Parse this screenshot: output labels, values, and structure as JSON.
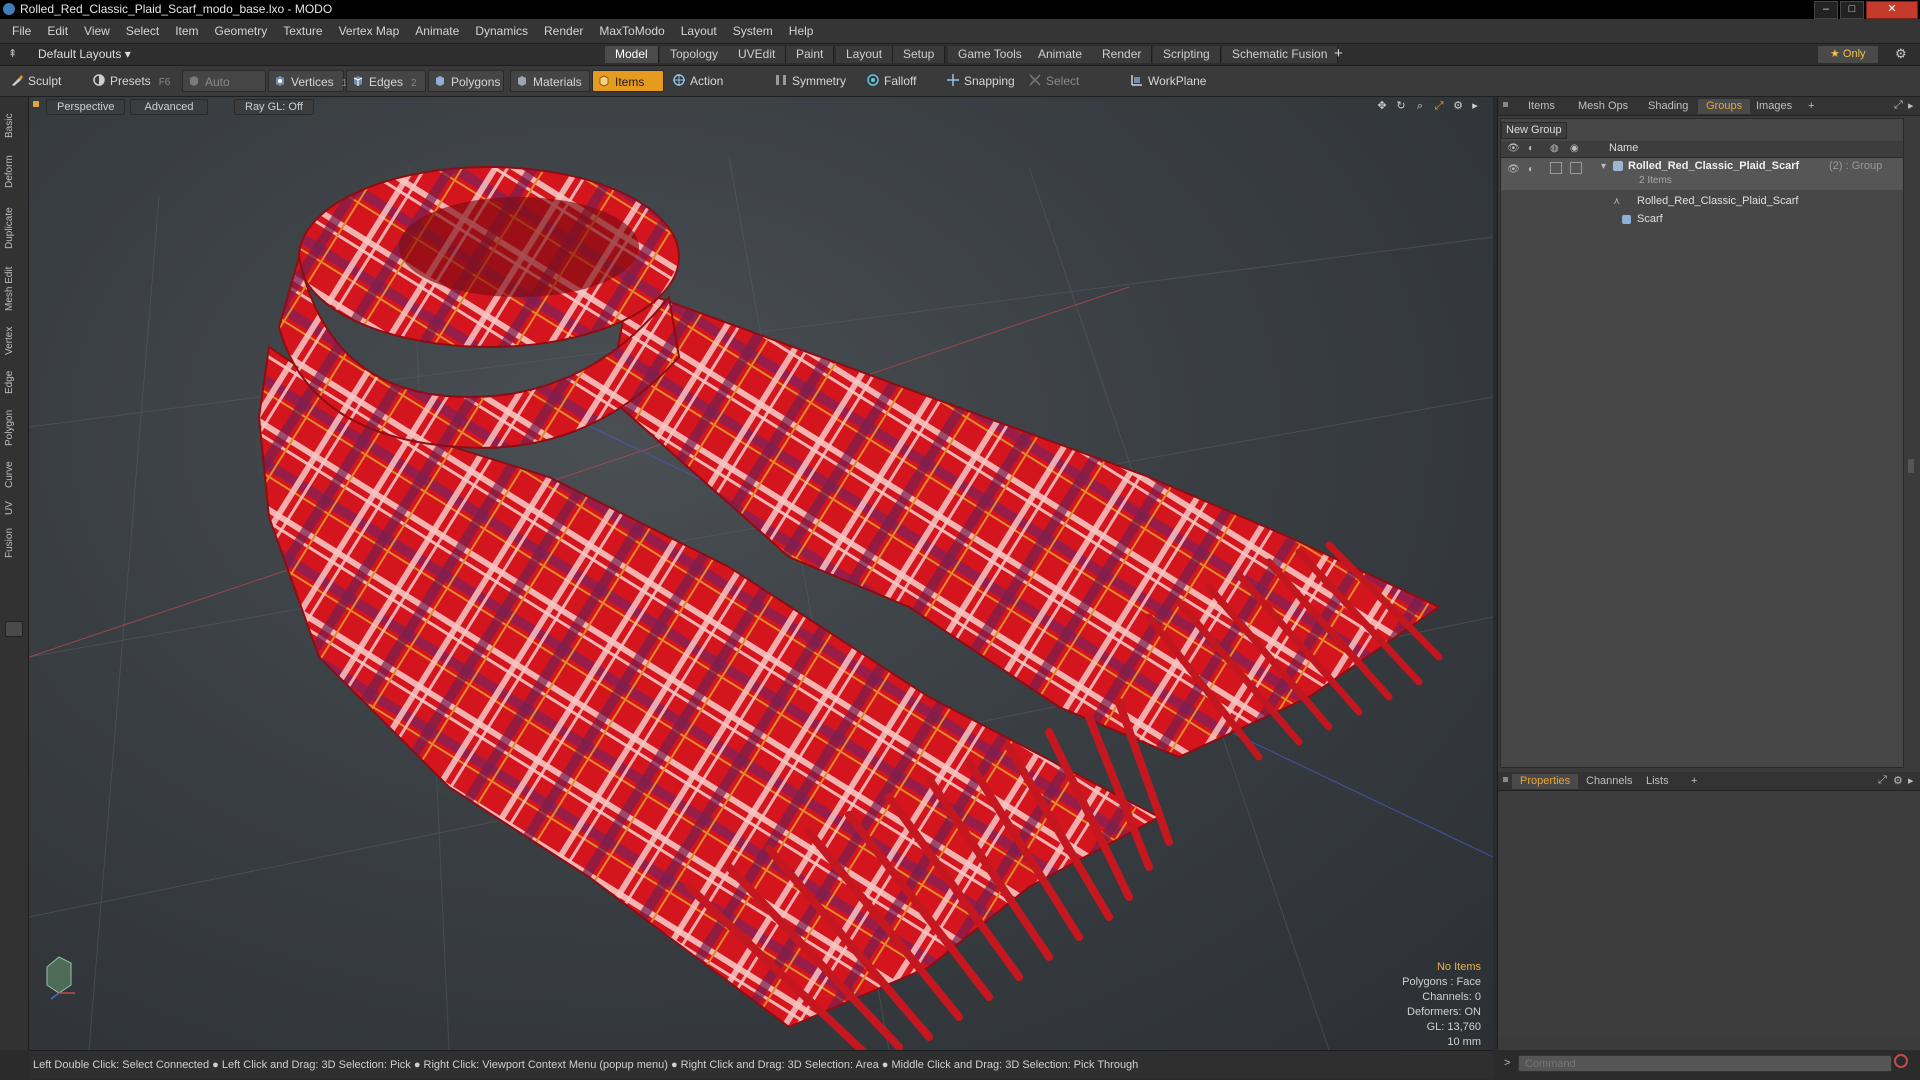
{
  "window": {
    "title": "Rolled_Red_Classic_Plaid_Scarf_modo_base.lxo - MODO",
    "controls": [
      "–",
      "□",
      "✕"
    ]
  },
  "menu": [
    "File",
    "Edit",
    "View",
    "Select",
    "Item",
    "Geometry",
    "Texture",
    "Vertex Map",
    "Animate",
    "Dynamics",
    "Render",
    "MaxToModo",
    "Layout",
    "System",
    "Help"
  ],
  "layout_bar": {
    "preset": "Default Layouts ▾",
    "tabs": [
      "Model",
      "Topology",
      "UVEdit",
      "Paint",
      "Layout",
      "Setup",
      "Game Tools",
      "Animate",
      "Render",
      "Scripting",
      "Schematic Fusion"
    ],
    "active_tab": "Model",
    "add_label": "+",
    "only_label": "★  Only"
  },
  "toolbar": {
    "sculpt": "Sculpt",
    "presets": "Presets",
    "presets_key": "F6",
    "auto_select": "Auto Select",
    "vertices": "Vertices",
    "vertices_count": "1",
    "edges": "Edges",
    "edges_count": "2",
    "polygons": "Polygons",
    "materials": "Materials",
    "items": "Items",
    "action_center": "Action Center",
    "symmetry": "Symmetry",
    "falloff": "Falloff",
    "snapping": "Snapping",
    "select_through": "Select Through",
    "workplane": "WorkPlane",
    "accent": "#e69a1e"
  },
  "left_tabs": [
    "Basic",
    "Deform",
    "Duplicate",
    "Mesh Edit",
    "Vertex",
    "Edge",
    "Polygon",
    "Curve",
    "UV",
    "Fusion"
  ],
  "viewport": {
    "view": "Perspective",
    "shading": "Advanced",
    "raygl": "Ray GL: Off",
    "stats": {
      "items": "No Items",
      "polygons": "Polygons : Face",
      "channels": "Channels: 0",
      "deformers": "Deformers: ON",
      "gl": "GL: 13,760",
      "scale": "10 mm"
    }
  },
  "groups_panel": {
    "tabs": [
      "Items",
      "Mesh Ops",
      "Shading",
      "Groups",
      "Images",
      "+"
    ],
    "active_tab": "Groups",
    "new_group": "New Group",
    "column_name": "Name",
    "group_name": "Rolled_Red_Classic_Plaid_Scarf",
    "group_suffix": "(2) : Group",
    "group_count": "2 Items",
    "children": [
      "Rolled_Red_Classic_Plaid_Scarf",
      "Scarf"
    ]
  },
  "properties_panel": {
    "tabs": [
      "Properties",
      "Channels",
      "Lists",
      "+"
    ],
    "active_tab": "Properties"
  },
  "command_placeholder": "Command",
  "status_bar": "Left Double Click: Select Connected ● Left Click and Drag: 3D Selection: Pick ● Right Click: Viewport Context Menu (popup menu) ● Right Click and Drag: 3D Selection: Area ● Middle Click and Drag: 3D Selection: Pick Through"
}
